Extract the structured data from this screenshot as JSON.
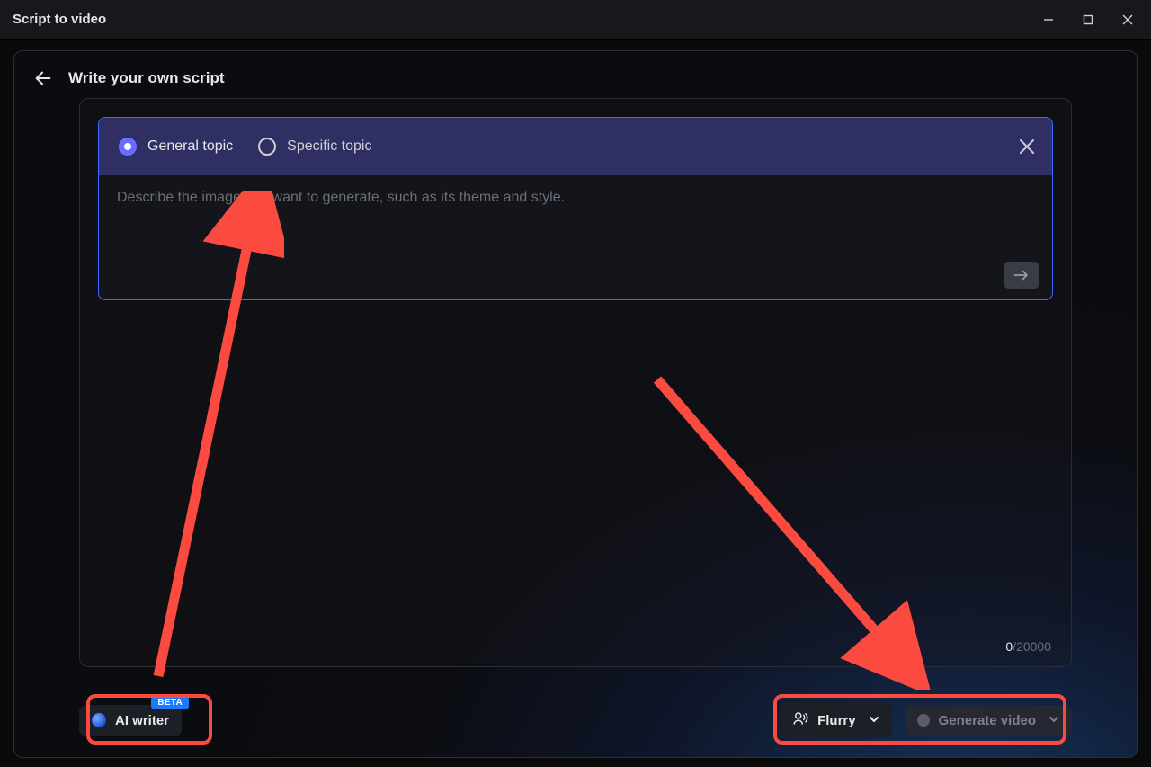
{
  "titlebar": {
    "title": "Script to video"
  },
  "header": {
    "title": "Write your own script"
  },
  "prompt": {
    "tabs": {
      "general": "General topic",
      "specific": "Specific topic",
      "selected": "general"
    },
    "placeholder": "Describe the image you want to generate, such as its theme and style."
  },
  "counter": {
    "current": "0",
    "max": "20000",
    "sep": "/"
  },
  "footer": {
    "ai_writer_label": "AI writer",
    "ai_writer_badge": "BETA",
    "voice_label": "Flurry",
    "generate_label": "Generate video"
  }
}
